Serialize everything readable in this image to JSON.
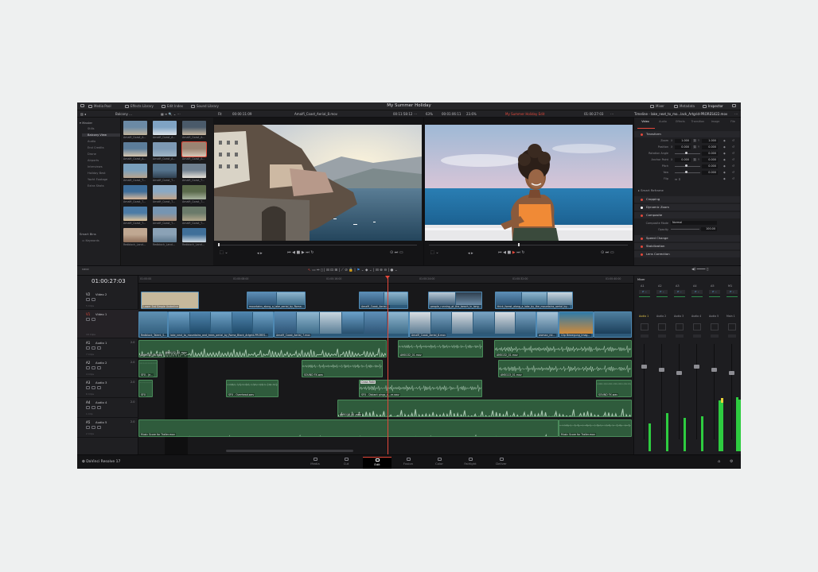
{
  "app": {
    "title": "My Summer Holiday",
    "product": "DaVinci Resolve 17"
  },
  "topbar": {
    "media_pool": "Media Pool",
    "effects_library": "Effects Library",
    "edit_index": "Edit Index",
    "sound_library": "Sound Library",
    "mixer": "Mixer",
    "metadata": "Metadata",
    "inspector": "Inspector"
  },
  "subbar": {
    "bin": "Balcony ...",
    "zoom": "Fit",
    "source_tc": "00:00:11:09",
    "source_clip": "Amalfi_Coast_Aerial_8.mov",
    "source_dur": "00:11:58:12",
    "zoom2": "63%",
    "timeline_tc": "00:01:06:11",
    "zoom3": "23.6%",
    "timeline_name": "My Summer Holiday Edit",
    "record_tc": "01:00:27:03",
    "inspector_title": "Timeline - lake_next_to_mo...lack_Artgrid-PRORES422.mov"
  },
  "sidebar": {
    "master": "Master",
    "items": [
      "Stills",
      "Balcony View",
      "Audio",
      "End Credits",
      "Drone",
      "Airports",
      "Interviews",
      "Holiday Best",
      "Yacht Footage",
      "Extra Shots"
    ],
    "smart_bins": "Smart Bins",
    "smart_items": [
      "Keywords"
    ]
  },
  "pool": [
    "Amalfi_Coast_A...",
    "Amalfi_Coast_A...",
    "Amalfi_Coast_A...",
    "Amalfi_Coast_A...",
    "Amalfi_Coast_A...",
    "Amalfi_Coast_A...",
    "Amalfi_Coast_T...",
    "Amalfi_Coast_T...",
    "Amalfi_Coast_T...",
    "Amalfi_Coast_T...",
    "Amalfi_Coast_T...",
    "Amalfi_Coast_T...",
    "Amalfi_Coast_T...",
    "Amalfi_Coast_T...",
    "Amalfi_Coast_T...",
    "Redblock_Land...",
    "Redblock_Land...",
    "Redblock_Land..."
  ],
  "inspector": {
    "tabs": [
      "Video",
      "Audio",
      "Effects",
      "Transition",
      "Image",
      "File"
    ],
    "transform": "Transform",
    "fields": [
      {
        "label": "Zoom",
        "x": "1.000",
        "y": "1.000"
      },
      {
        "label": "Position",
        "x": "0.000",
        "y": "0.000"
      },
      {
        "label": "Rotation Angle",
        "x": "",
        "y": "0.000"
      },
      {
        "label": "Anchor Point",
        "x": "0.000",
        "y": "0.000"
      },
      {
        "label": "Pitch",
        "x": "",
        "y": "0.000"
      },
      {
        "label": "Yaw",
        "x": "",
        "y": "0.000"
      },
      {
        "label": "Flip",
        "x": "",
        "y": ""
      }
    ],
    "smart_reframe": "Smart Reframe",
    "cropping": "Cropping",
    "dynamic_zoom": "Dynamic Zoom",
    "composite": "Composite",
    "composite_mode_label": "Composite Mode",
    "composite_mode_value": "Normal",
    "opacity_label": "Opacity",
    "opacity_value": "100.00",
    "speed_change": "Speed Change",
    "stabilization": "Stabilization",
    "lens_correction": "Lens Correction"
  },
  "timeline": {
    "timecode": "01:00:27:03",
    "ruler": [
      "01:00:00",
      "01:00:08:00",
      "01:00:16:00",
      "01:00:24:00",
      "01:00:32:00",
      "01:00:40:00"
    ],
    "tracks": [
      {
        "code": "V2",
        "name": "Video 2",
        "meta": "5 Clips"
      },
      {
        "code": "V1",
        "name": "Video 1",
        "meta": "19 Clips"
      },
      {
        "code": "A1",
        "name": "Audio 1",
        "level": "2.0",
        "meta": "7 Clips"
      },
      {
        "code": "A2",
        "name": "Audio 2",
        "level": "2.0",
        "meta": "4 Clips"
      },
      {
        "code": "A3",
        "name": "Audio 3",
        "level": "2.0",
        "meta": "6 Clips"
      },
      {
        "code": "A4",
        "name": "Audio 4",
        "level": "2.0",
        "meta": "1 Clip"
      },
      {
        "code": "A5",
        "name": "Audio 5",
        "level": "2.0",
        "meta": "2 Clips"
      }
    ],
    "clips": {
      "v2": [
        "Lower 3rd Simple Underline",
        "mountains_along_a_lake_aerial_by_Roma...",
        "Amalfi_Coast_Aerial...",
        "people_running_at_the_beach_in_long...",
        "thick_forest_along_a_lake_by_the_mountains_aerial_by..."
      ],
      "v1": [
        "Redblock_Talent_S...",
        "lake_next_to_mountains_and_trees_aerial_by_Roma_Black_Artgrid-PRORES...",
        "Amalfi_Coast_Aerial_7.mov",
        "Amalfi_Coast_Aerial_8.mov",
        "woman_rid...",
        "Clip Bewegung_Imag..."
      ],
      "a1": [
        "AM0132_01.mov",
        "AM0132_01.mov",
        "AM0132_01.mov",
        "AM0132_01.mov"
      ],
      "a2": [
        "SFX - Je...",
        "SOUND FX.wav",
        "AM0113_01.mov"
      ],
      "a3": [
        "SFX",
        "SFX - Overhead.wav",
        "Cross Fade",
        "SFX - Distant pings_d...re.wav",
        "SOUND FX.wav"
      ],
      "a4": [
        "AM0113_01.mov"
      ],
      "a5": [
        "Music Score for Trailer.mov",
        "Music Score for Trailer.mov"
      ]
    }
  },
  "mixer": {
    "title": "Mixer",
    "channels": [
      "A1",
      "A2",
      "A3",
      "A4",
      "A5",
      "M1"
    ],
    "strips": [
      "Audio 1",
      "Audio 2",
      "Audio 3",
      "Audio 4",
      "Audio 5",
      "Main 1"
    ],
    "levels": [
      0.32,
      0.44,
      0.38,
      0.4,
      0.58,
      0.62
    ]
  },
  "nav": {
    "items": [
      "Media",
      "Cut",
      "Edit",
      "Fusion",
      "Color",
      "Fairlight",
      "Deliver"
    ],
    "active": "Edit"
  },
  "colors": {
    "accent": "#e5483b",
    "video_clip": "#2d5a7a",
    "audio_clip": "#2f5b3c",
    "meter": "#2ecc40"
  }
}
